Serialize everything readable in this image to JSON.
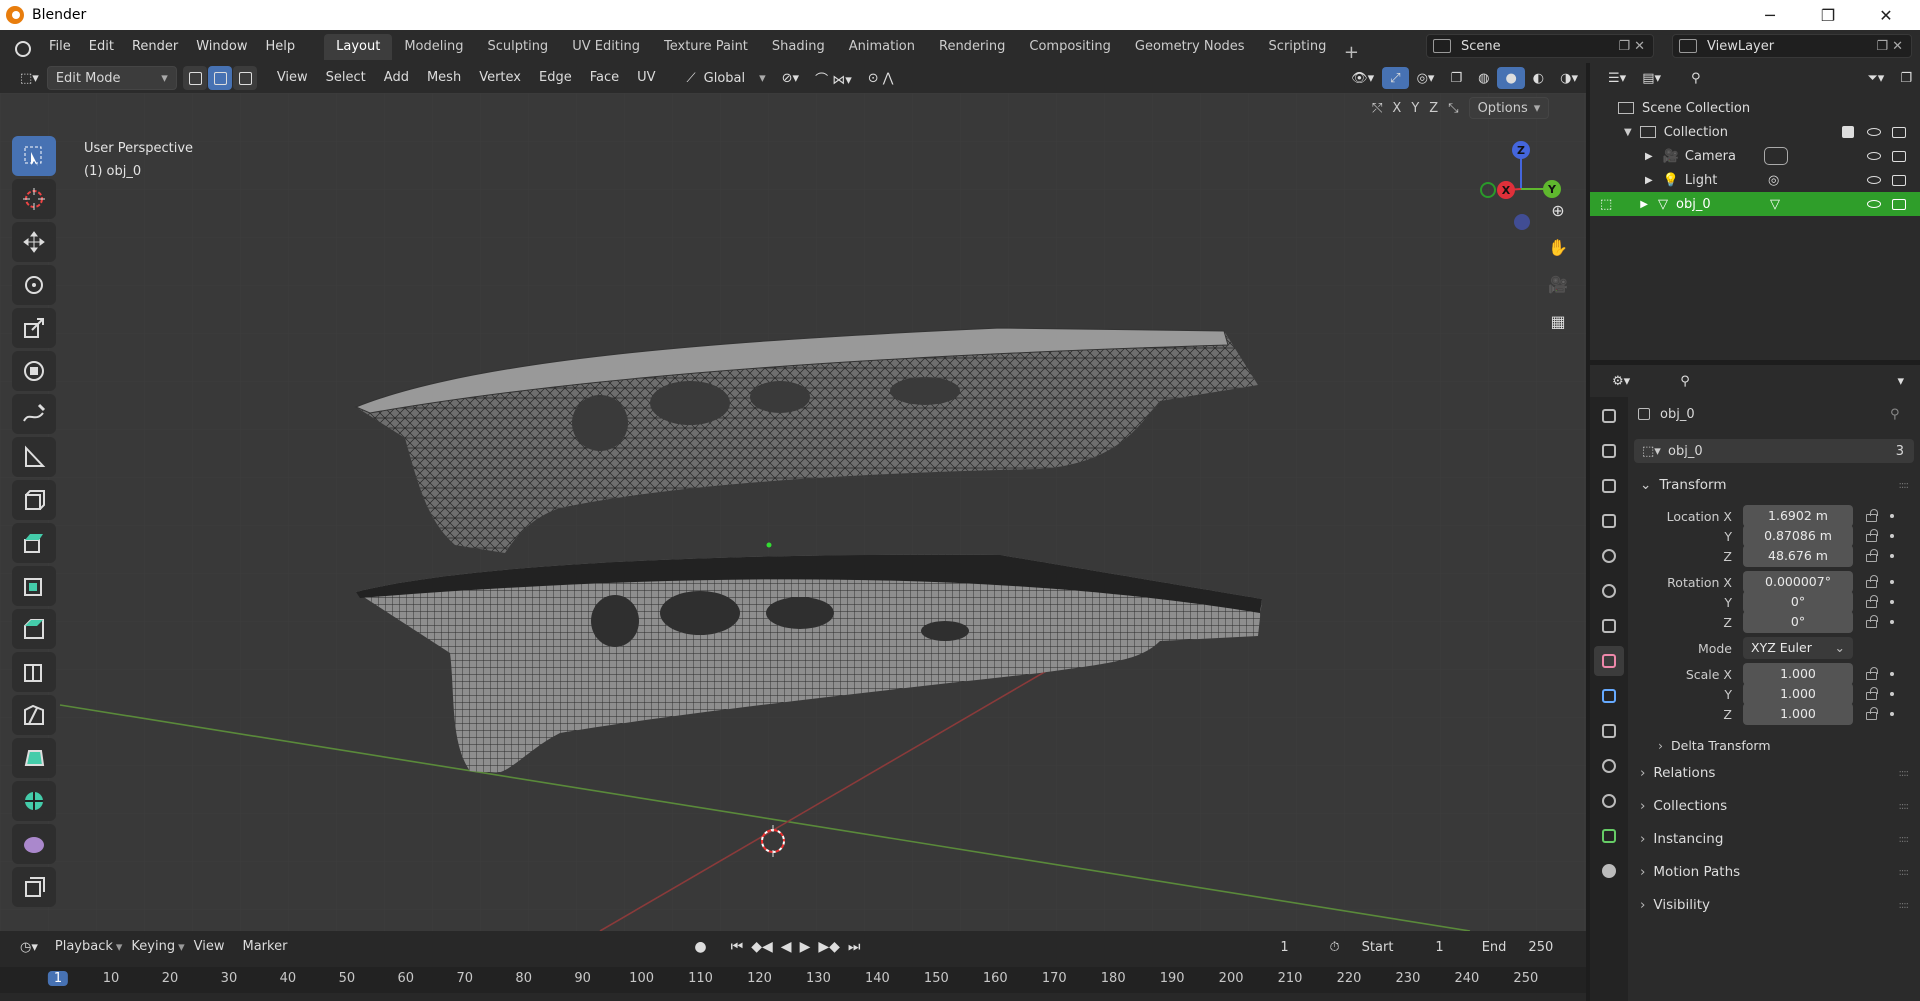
{
  "window": {
    "title": "Blender",
    "minimize": "─",
    "maximize": "❐",
    "close": "✕"
  },
  "menus": [
    "File",
    "Edit",
    "Render",
    "Window",
    "Help"
  ],
  "workspaces": [
    "Layout",
    "Modeling",
    "Sculpting",
    "UV Editing",
    "Texture Paint",
    "Shading",
    "Animation",
    "Rendering",
    "Compositing",
    "Geometry Nodes",
    "Scripting"
  ],
  "active_workspace": "Layout",
  "scene": {
    "name": "Scene",
    "view_layer": "ViewLayer"
  },
  "viewport_header": {
    "mode": "Edit Mode",
    "menus": [
      "View",
      "Select",
      "Add",
      "Mesh",
      "Vertex",
      "Edge",
      "Face",
      "UV"
    ],
    "transform_orientation": "Global",
    "axes": [
      "X",
      "Y",
      "Z"
    ],
    "options": "Options"
  },
  "viewport": {
    "perspective": "User Perspective",
    "object_info": "(1) obj_0"
  },
  "gizmo": {
    "x": "X",
    "y": "Y",
    "z": "Z"
  },
  "timeline": {
    "menus": [
      "Playback",
      "Keying",
      "View",
      "Marker"
    ],
    "current_frame": "1",
    "start_label": "Start",
    "start": "1",
    "end_label": "End",
    "end": "250",
    "ticks": [
      "1",
      "10",
      "20",
      "30",
      "40",
      "50",
      "60",
      "70",
      "80",
      "90",
      "100",
      "110",
      "120",
      "130",
      "140",
      "150",
      "160",
      "170",
      "180",
      "190",
      "200",
      "210",
      "220",
      "230",
      "240",
      "250"
    ]
  },
  "outliner": {
    "root": "Scene Collection",
    "collection": "Collection",
    "items": [
      "Camera",
      "Light",
      "obj_0"
    ],
    "selected": "obj_0"
  },
  "properties": {
    "object_name": "obj_0",
    "data_name": "obj_0",
    "users": "3",
    "transform_header": "Transform",
    "location": {
      "label_x": "Location X",
      "label_y": "Y",
      "label_z": "Z",
      "x": "1.6902 m",
      "y": "0.87086 m",
      "z": "48.676 m"
    },
    "rotation": {
      "label_x": "Rotation X",
      "label_y": "Y",
      "label_z": "Z",
      "x": "0.000007°",
      "y": "0°",
      "z": "0°"
    },
    "mode_label": "Mode",
    "mode": "XYZ Euler",
    "scale": {
      "label_x": "Scale X",
      "label_y": "Y",
      "label_z": "Z",
      "x": "1.000",
      "y": "1.000",
      "z": "1.000"
    },
    "subsections": [
      "Delta Transform"
    ],
    "panels": [
      "Relations",
      "Collections",
      "Instancing",
      "Motion Paths",
      "Visibility"
    ]
  },
  "colors": {
    "accent": "#4772b3",
    "selection": "#2f9e2a",
    "axis_x": "#e0303a",
    "axis_y": "#5fb82e",
    "axis_z": "#4466dd"
  }
}
